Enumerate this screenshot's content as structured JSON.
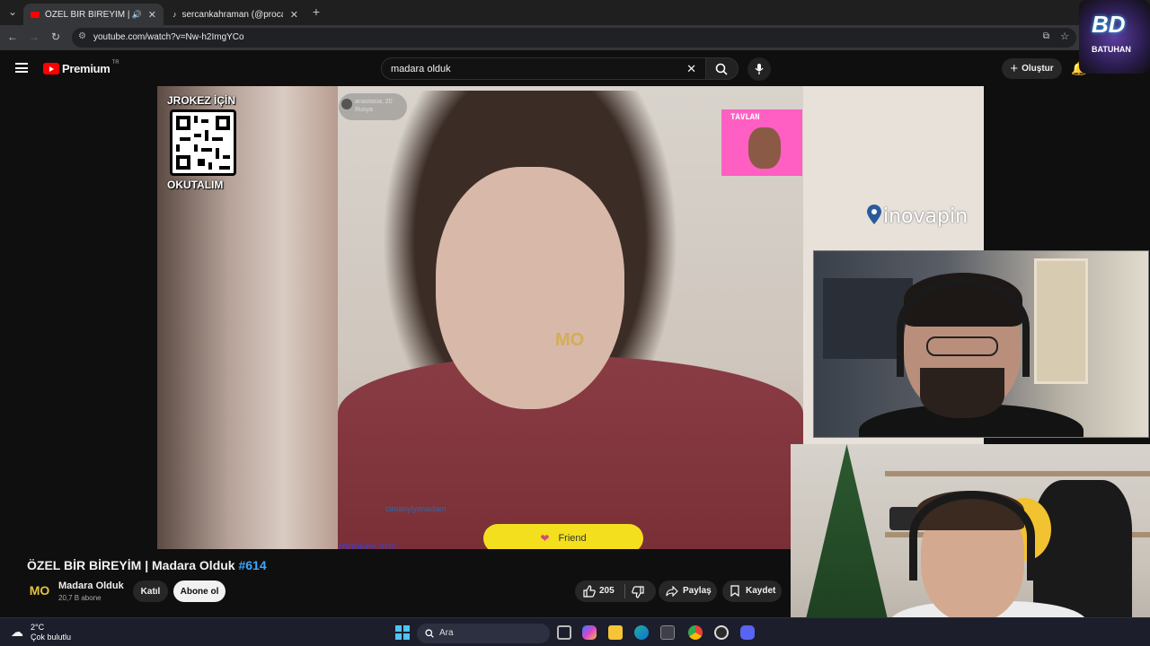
{
  "browser": {
    "tabs": [
      {
        "label": "ÖZEL BİR BİREYİM | Madara",
        "active": true
      },
      {
        "label": "sercankahraman (@procanserc",
        "active": false
      }
    ],
    "url": "youtube.com/watch?v=Nw-h2ImgYCo"
  },
  "youtube": {
    "logo_label": "Premium",
    "logo_region": "TR",
    "search_value": "madara olduk",
    "create_label": "Oluştur"
  },
  "video_overlay": {
    "qr_title": "JROKEZ İÇİN",
    "qr_bottom": "OKUTALIM",
    "top_user_name": "anastasia, 20",
    "top_user_country": "Rusya",
    "streamer_tag": "TAVLAN",
    "watermark": "MO",
    "sponsor": "inovapin",
    "chat_name": "cimanyiyenadam",
    "app_label": "monkey.app",
    "friend_button": "Friend"
  },
  "logo_overlay": {
    "big": "BD",
    "small": "BATUHAN"
  },
  "video": {
    "title": "ÖZEL BİR BİREYİM | Madara Olduk",
    "hashtag": "#614",
    "channel_avatar": "MO",
    "channel_name": "Madara Olduk",
    "subscribers": "20,7 B abone",
    "join_label": "Katıl",
    "subscribe_label": "Abone ol",
    "like_count": "205",
    "share_label": "Paylaş",
    "save_label": "Kaydet"
  },
  "taskbar": {
    "weather_temp": "2°C",
    "weather_desc": "Çok bulutlu",
    "search_label": "Ara"
  },
  "colors": {
    "yt_red": "#ff0000",
    "link_blue": "#3ea6ff",
    "friend_yellow": "#f3df1e"
  }
}
